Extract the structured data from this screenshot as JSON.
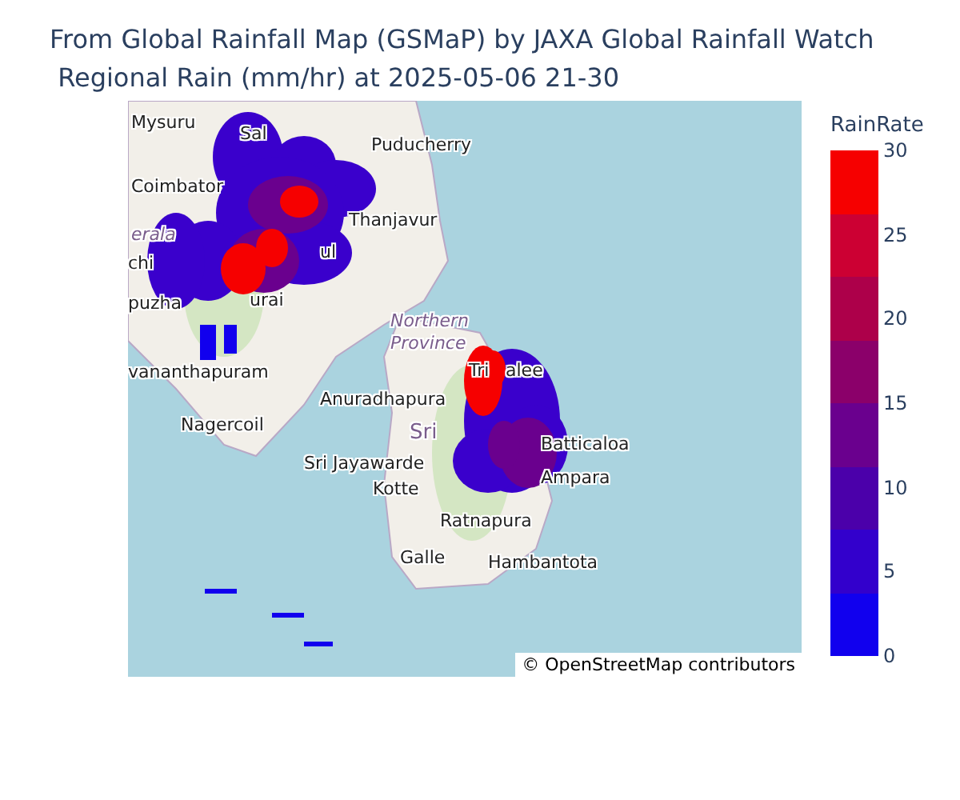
{
  "title": {
    "line_1": "From Global Rainfall Map (GSMaP) by JAXA Global Rainfall Watch",
    "line_2": " Regional Rain (mm/hr) at 2025-05-06 21-30"
  },
  "map": {
    "place_labels": [
      {
        "text": "Mysuru",
        "kind": "city"
      },
      {
        "text": "Sal",
        "kind": "city"
      },
      {
        "text": "Puducherry",
        "kind": "city"
      },
      {
        "text": "Coimbator",
        "kind": "city"
      },
      {
        "text": "Thanjavur",
        "kind": "city"
      },
      {
        "text": "erala",
        "kind": "region"
      },
      {
        "text": "chi",
        "kind": "city"
      },
      {
        "text": "ul",
        "kind": "city"
      },
      {
        "text": "urai",
        "kind": "city"
      },
      {
        "text": "puzha",
        "kind": "city"
      },
      {
        "text": "Northern",
        "kind": "region"
      },
      {
        "text": "Province",
        "kind": "region"
      },
      {
        "text": "vananthapuram",
        "kind": "city"
      },
      {
        "text": "Tri",
        "kind": "city"
      },
      {
        "text": "alee",
        "kind": "city"
      },
      {
        "text": "Anuradhapura",
        "kind": "city"
      },
      {
        "text": "Nagercoil",
        "kind": "city"
      },
      {
        "text": "Sri",
        "kind": "country"
      },
      {
        "text": "Batticaloa",
        "kind": "city"
      },
      {
        "text": "Sri Jayawarde",
        "kind": "city"
      },
      {
        "text": "Ampara",
        "kind": "city"
      },
      {
        "text": "Kotte",
        "kind": "city"
      },
      {
        "text": "Ratnapura",
        "kind": "city"
      },
      {
        "text": "Galle",
        "kind": "city"
      },
      {
        "text": "Hambantota",
        "kind": "city"
      }
    ],
    "attribution": "© OpenStreetMap contributors"
  },
  "colorbar": {
    "title": "RainRate",
    "bands": [
      {
        "color": "#f60000"
      },
      {
        "color": "#cc0033"
      },
      {
        "color": "#ad004a"
      },
      {
        "color": "#8b006a"
      },
      {
        "color": "#6a008e"
      },
      {
        "color": "#4b00aa"
      },
      {
        "color": "#3300cc"
      },
      {
        "color": "#1100ee"
      }
    ],
    "ticks": [
      "30",
      "25",
      "20",
      "15",
      "10",
      "5",
      "0"
    ]
  }
}
